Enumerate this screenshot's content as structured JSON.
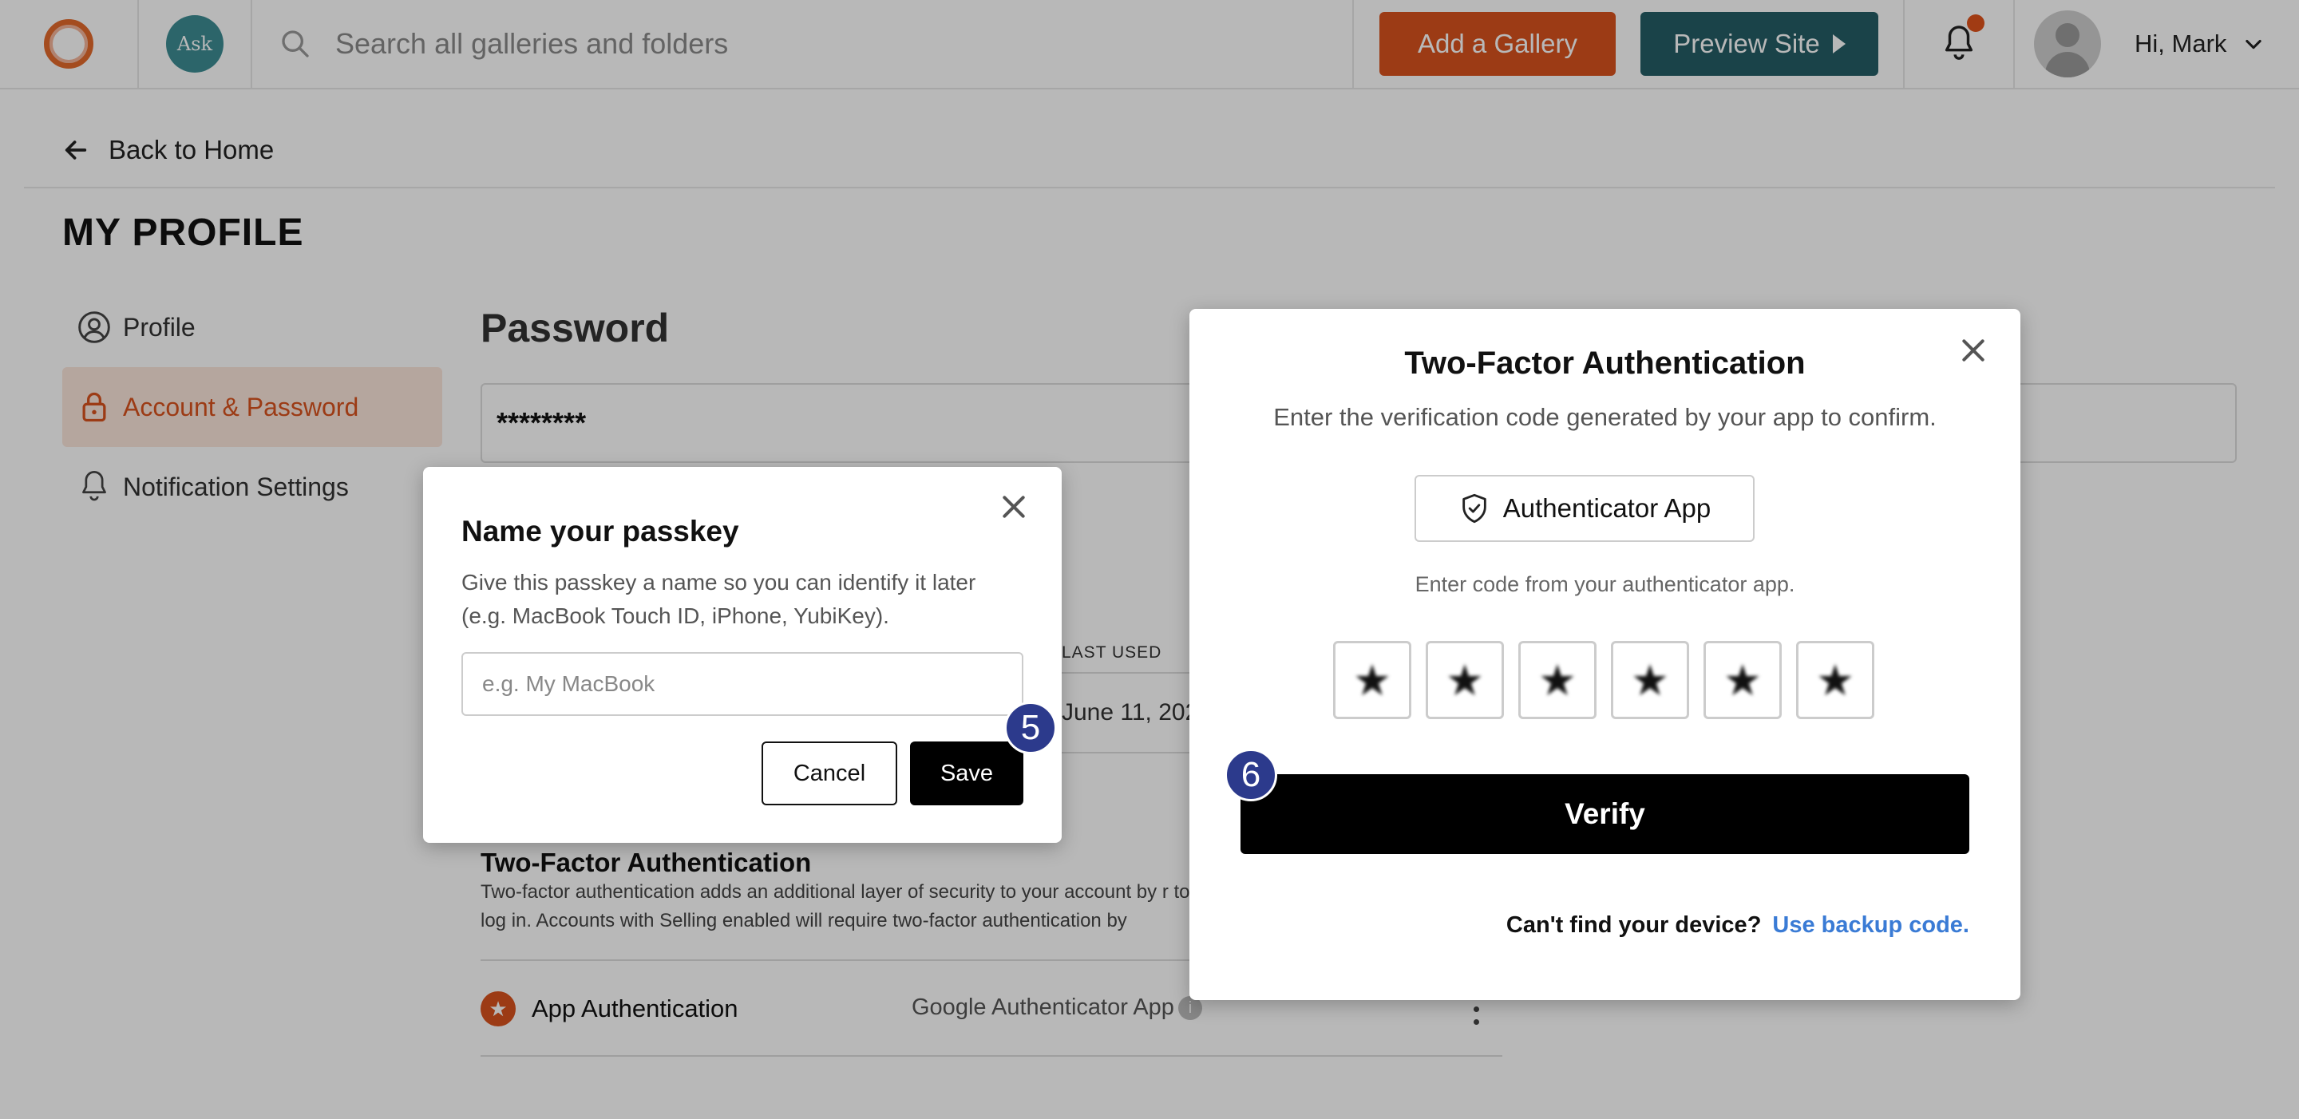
{
  "header": {
    "logo_icon": "brand-ring-icon",
    "ask_label": "Ask",
    "search_placeholder": "Search all galleries and folders",
    "add_gallery_label": "Add a Gallery",
    "add_gallery_color": "#d9531e",
    "preview_site_label": "Preview Site",
    "preview_site_color": "#245e66",
    "greeting": "Hi, Mark"
  },
  "page": {
    "back_label": "Back to Home",
    "title": "MY PROFILE"
  },
  "sidebar": {
    "items": [
      {
        "label": "Profile",
        "icon": "user-circle-icon",
        "active": false
      },
      {
        "label": "Account & Password",
        "icon": "lock-icon",
        "active": true
      },
      {
        "label": "Notification Settings",
        "icon": "bell-icon",
        "active": false
      }
    ]
  },
  "main": {
    "password_section_title": "Password",
    "password_value": "********",
    "passkeys_table": {
      "column_last_used": "LAST USED",
      "row_date": "June 11, 202"
    },
    "two_factor": {
      "title": "Two-Factor Authentication",
      "description": "Two-factor authentication adds an additional layer of security to your account by r to log in. Accounts with Selling enabled will require two-factor authentication by",
      "app_row_label": "App Authentication",
      "app_row_value": "Google Authenticator App"
    }
  },
  "passkey_modal": {
    "title": "Name your passkey",
    "description": "Give this passkey a name so you can identify it later (e.g. MacBook Touch ID, iPhone, YubiKey).",
    "input_placeholder": "e.g. My MacBook",
    "cancel_label": "Cancel",
    "save_label": "Save",
    "step_number": "5"
  },
  "tfa_modal": {
    "title": "Two-Factor Authentication",
    "subtitle": "Enter the verification code generated by your app to confirm.",
    "method_label": "Authenticator App",
    "hint": "Enter code from your authenticator app.",
    "otp_digits": [
      "★",
      "★",
      "★",
      "★",
      "★",
      "★"
    ],
    "verify_label": "Verify",
    "footer_question": "Can't find your device?",
    "footer_link": "Use backup code.",
    "step_number": "6"
  }
}
